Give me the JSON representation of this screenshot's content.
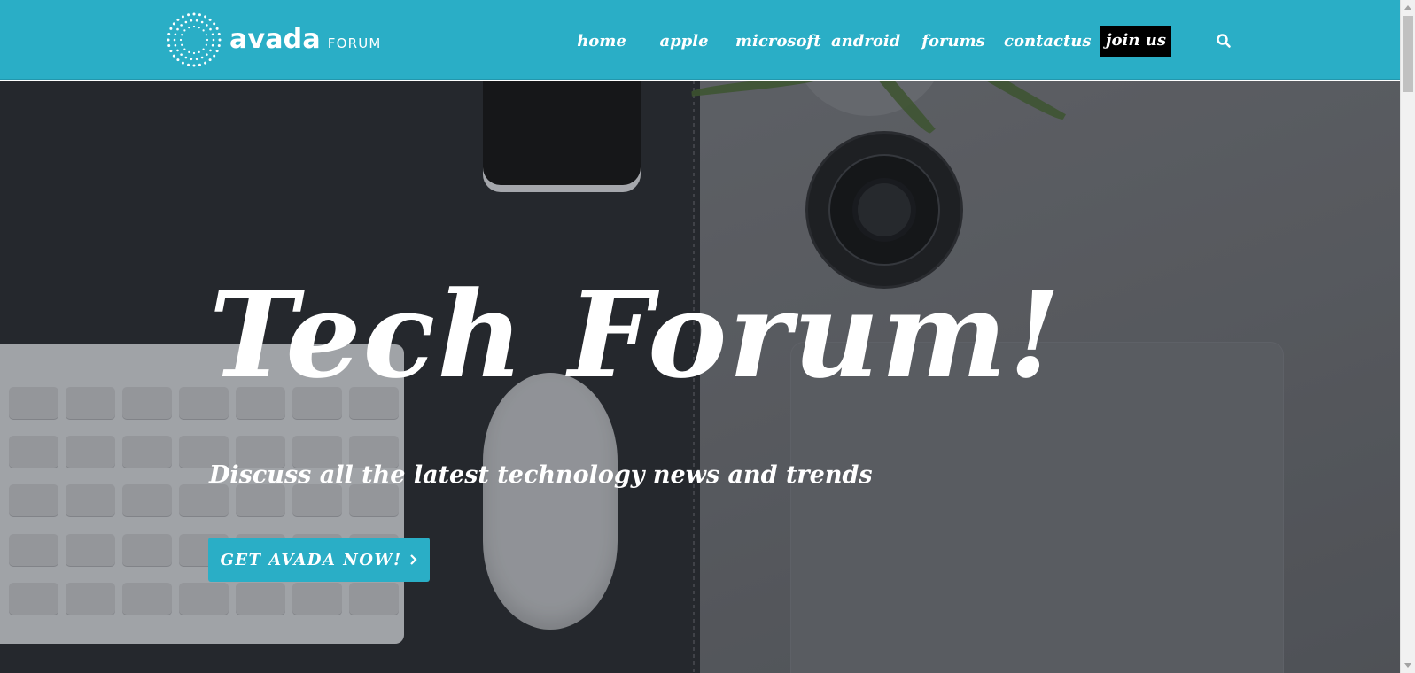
{
  "header": {
    "logo": {
      "word": "avada",
      "sub": "FORUM",
      "mark_icon": "dotted-circle-logo-icon"
    },
    "nav": [
      {
        "label": "home",
        "name": "nav-home"
      },
      {
        "label": "apple",
        "name": "nav-apple"
      },
      {
        "label": "microsoft",
        "name": "nav-microsoft"
      },
      {
        "label": "android",
        "name": "nav-android"
      },
      {
        "label": "forums",
        "name": "nav-forums"
      },
      {
        "label": "contactus",
        "name": "nav-contactus"
      },
      {
        "label": "join us",
        "name": "nav-join-us"
      }
    ],
    "search_icon": "search-icon"
  },
  "hero": {
    "title": "Tech Forum!",
    "subtitle": "Discuss all the latest technology news and trends",
    "cta_label": "GET AVADA NOW!",
    "cta_icon": "chevron-right-icon"
  },
  "colors": {
    "header_bg": "#2aaec6",
    "accent": "#2aaec6",
    "join_bg": "#000000",
    "text": "#ffffff"
  }
}
